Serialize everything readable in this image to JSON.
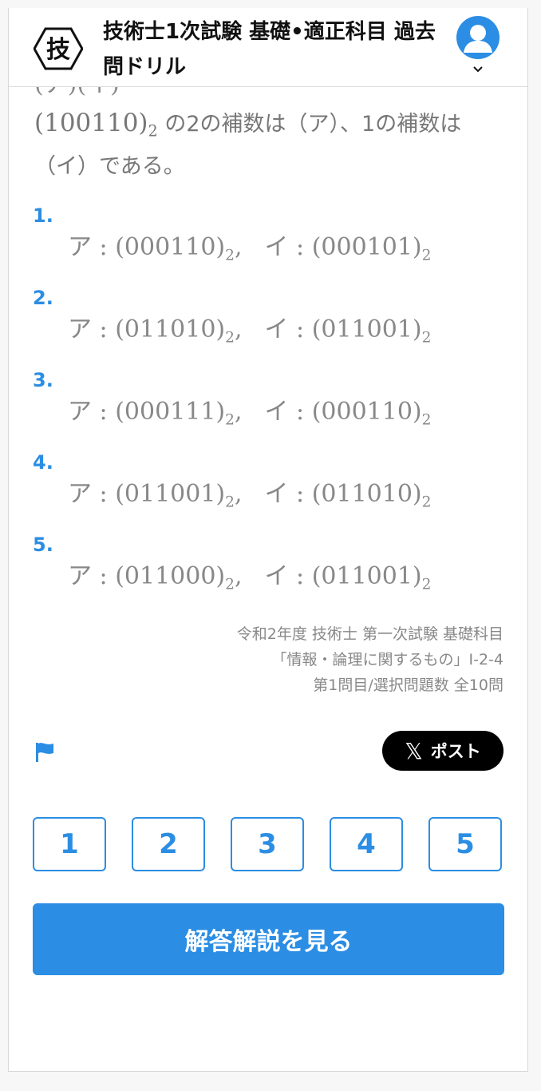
{
  "header": {
    "title": "技術士1次試験 基礎•適正科目 過去問ドリル",
    "logo_text": "技"
  },
  "question": {
    "partial_line": "(ア)(イ)",
    "number_main": "(100110)",
    "number_sub": "2",
    "text_rest": " の2の補数は（ア）、1の補数は（イ）である。"
  },
  "options": [
    {
      "num": "1.",
      "a_label": "ア",
      "a_val": "(000110)",
      "b_label": "イ",
      "b_val": "(000101)",
      "base": "2"
    },
    {
      "num": "2.",
      "a_label": "ア",
      "a_val": "(011010)",
      "b_label": "イ",
      "b_val": "(011001)",
      "base": "2"
    },
    {
      "num": "3.",
      "a_label": "ア",
      "a_val": "(000111)",
      "b_label": "イ",
      "b_val": "(000110)",
      "base": "2"
    },
    {
      "num": "4.",
      "a_label": "ア",
      "a_val": "(011001)",
      "b_label": "イ",
      "b_val": "(011010)",
      "base": "2"
    },
    {
      "num": "5.",
      "a_label": "ア",
      "a_val": "(011000)",
      "b_label": "イ",
      "b_val": "(011001)",
      "base": "2"
    }
  ],
  "source": {
    "line1": "令和2年度 技術士 第一次試験 基礎科目",
    "line2": "「情報・論理に関するもの」I-2-4",
    "line3": "第1問目/選択問題数 全10問"
  },
  "share": {
    "post_label": "ポスト",
    "x_glyph": "𝕏"
  },
  "answer_buttons": [
    "1",
    "2",
    "3",
    "4",
    "5"
  ],
  "explain_button": "解答解説を見る",
  "colors": {
    "accent": "#2b8de3",
    "text_muted": "#888888",
    "post_bg": "#000000"
  }
}
